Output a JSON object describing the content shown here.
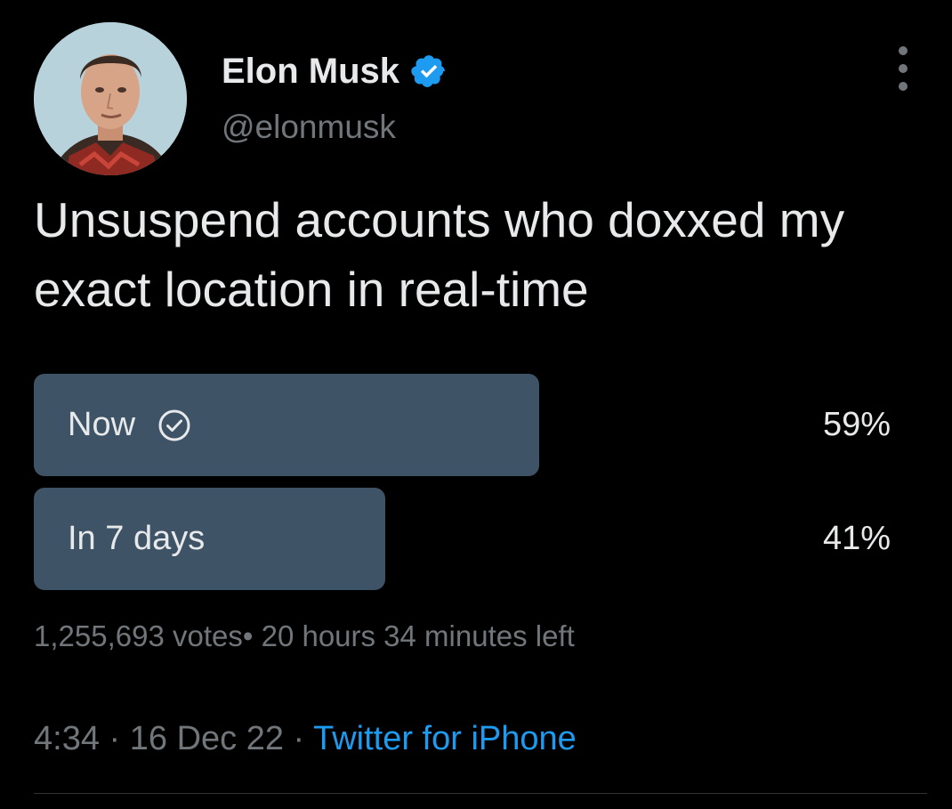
{
  "author": {
    "name": "Elon Musk",
    "handle": "@elonmusk",
    "verified_icon": "verified-badge-icon",
    "verified_color": "#1d9bf0"
  },
  "menu_icon": "more-vertical-icon",
  "tweet": {
    "text": "Unsuspend accounts who doxxed my exact location in real-time"
  },
  "poll": {
    "options": [
      {
        "label": "Now",
        "percent_label": "59%",
        "percent": 59,
        "selected": true,
        "selected_icon": "check-circle-icon"
      },
      {
        "label": "In 7 days",
        "percent_label": "41%",
        "percent": 41,
        "selected": false
      }
    ],
    "votes": "1,255,693 votes",
    "separator": "•",
    "time_left": "20 hours 34 minutes left",
    "bar_color": "#3e5365"
  },
  "meta": {
    "time": "4:34",
    "separator": "·",
    "date": "16 Dec 22",
    "source": "Twitter for iPhone",
    "link_color": "#1d9bf0"
  }
}
